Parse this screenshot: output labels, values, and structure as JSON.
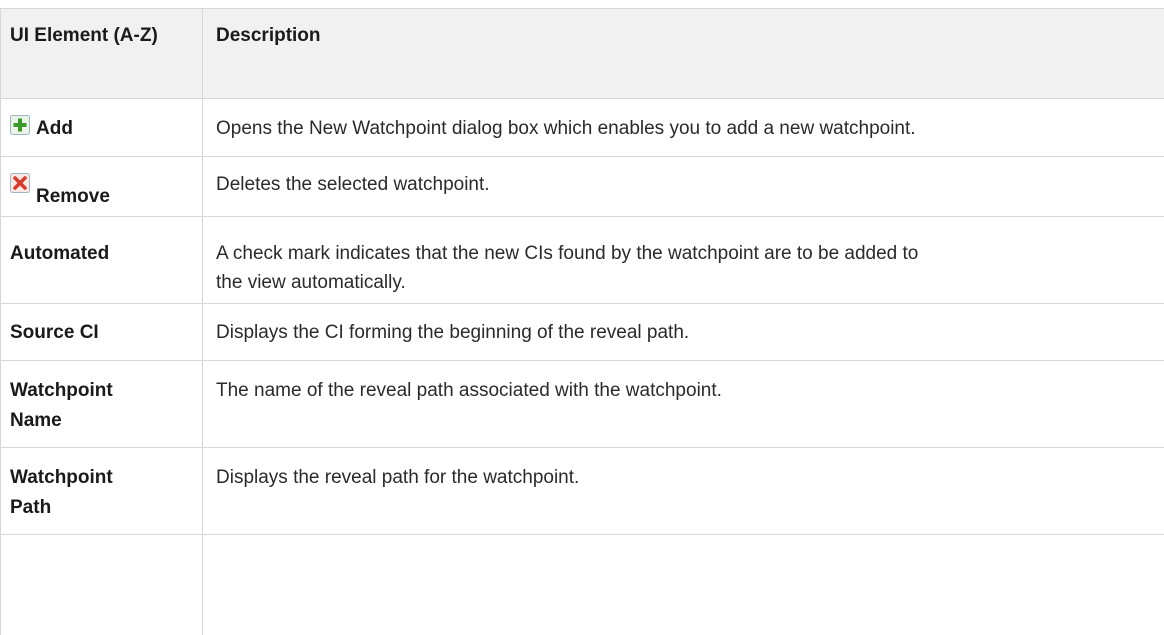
{
  "header": {
    "col1": "UI Element (A-Z)",
    "col2": "Description"
  },
  "rows": [
    {
      "element": "Add",
      "icon": "add-icon",
      "description": "Opens the New Watchpoint dialog box which enables you to add a new watchpoint."
    },
    {
      "element": "Remove",
      "icon": "remove-icon",
      "description": "Deletes the selected watchpoint."
    },
    {
      "element": "Automated",
      "description_line1": "A check mark indicates that the new CIs found by the watchpoint are to be added to",
      "description_line2": "the view automatically."
    },
    {
      "element": "Source CI",
      "description": "Displays the CI forming the beginning of the reveal path."
    },
    {
      "element_line1": "Watchpoint",
      "element_line2": "Name",
      "description": "The name of the reveal path associated with the watchpoint."
    },
    {
      "element_line1": "Watchpoint",
      "element_line2": "Path",
      "description": "Displays the reveal path for the watchpoint."
    }
  ],
  "colors": {
    "header_bg": "#f1f1f1",
    "grid": "#d6d6d6",
    "add_icon": "#3a9a2a",
    "remove_icon": "#d83a2a"
  }
}
